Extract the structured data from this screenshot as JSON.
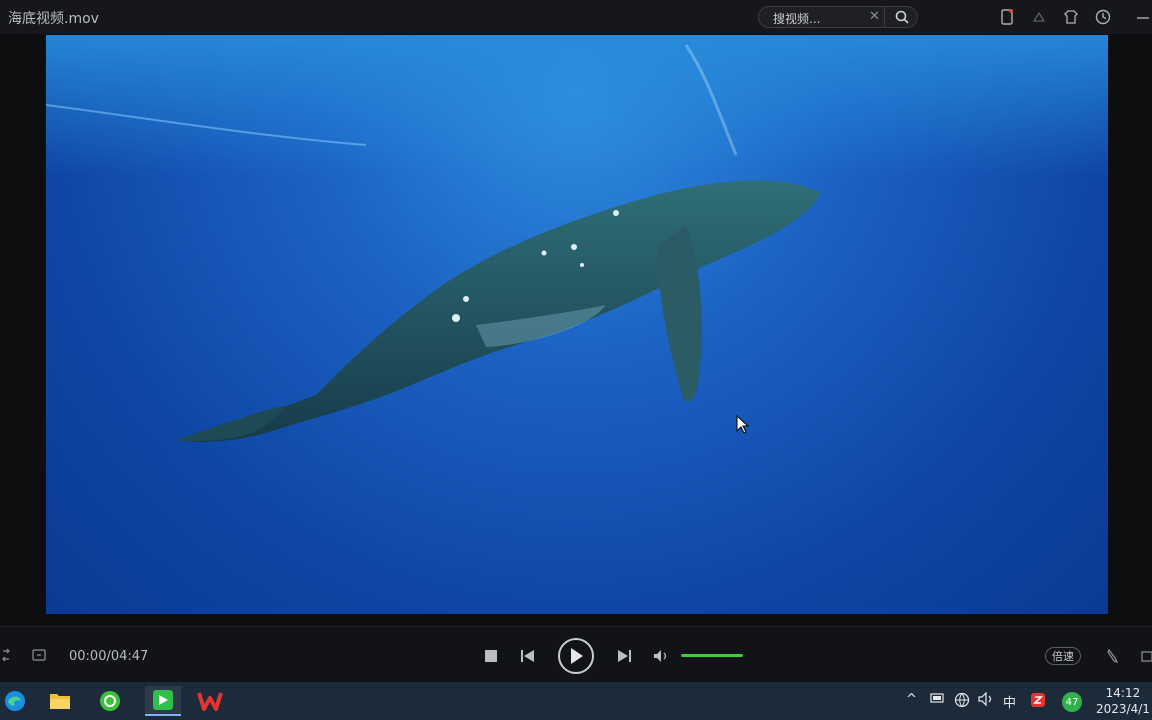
{
  "window": {
    "title": "海底视频.mov"
  },
  "search": {
    "placeholder": "搜视频..."
  },
  "player": {
    "time": "00:00/04:47",
    "speed_label": "倍速",
    "volume_level": 1.0
  },
  "taskbar": {
    "apps": [
      {
        "name": "edge-icon"
      },
      {
        "name": "file-explorer-icon"
      },
      {
        "name": "browser-icon"
      },
      {
        "name": "video-player-icon"
      },
      {
        "name": "wps-icon"
      }
    ],
    "tray": {
      "ime": "中",
      "badge": "47"
    },
    "clock": {
      "time": "14:12",
      "date": "2023/4/1"
    }
  },
  "colors": {
    "accent": "#3ecf3a",
    "video_bg": "#1c63c4",
    "taskbar": "#1c2a3a"
  }
}
